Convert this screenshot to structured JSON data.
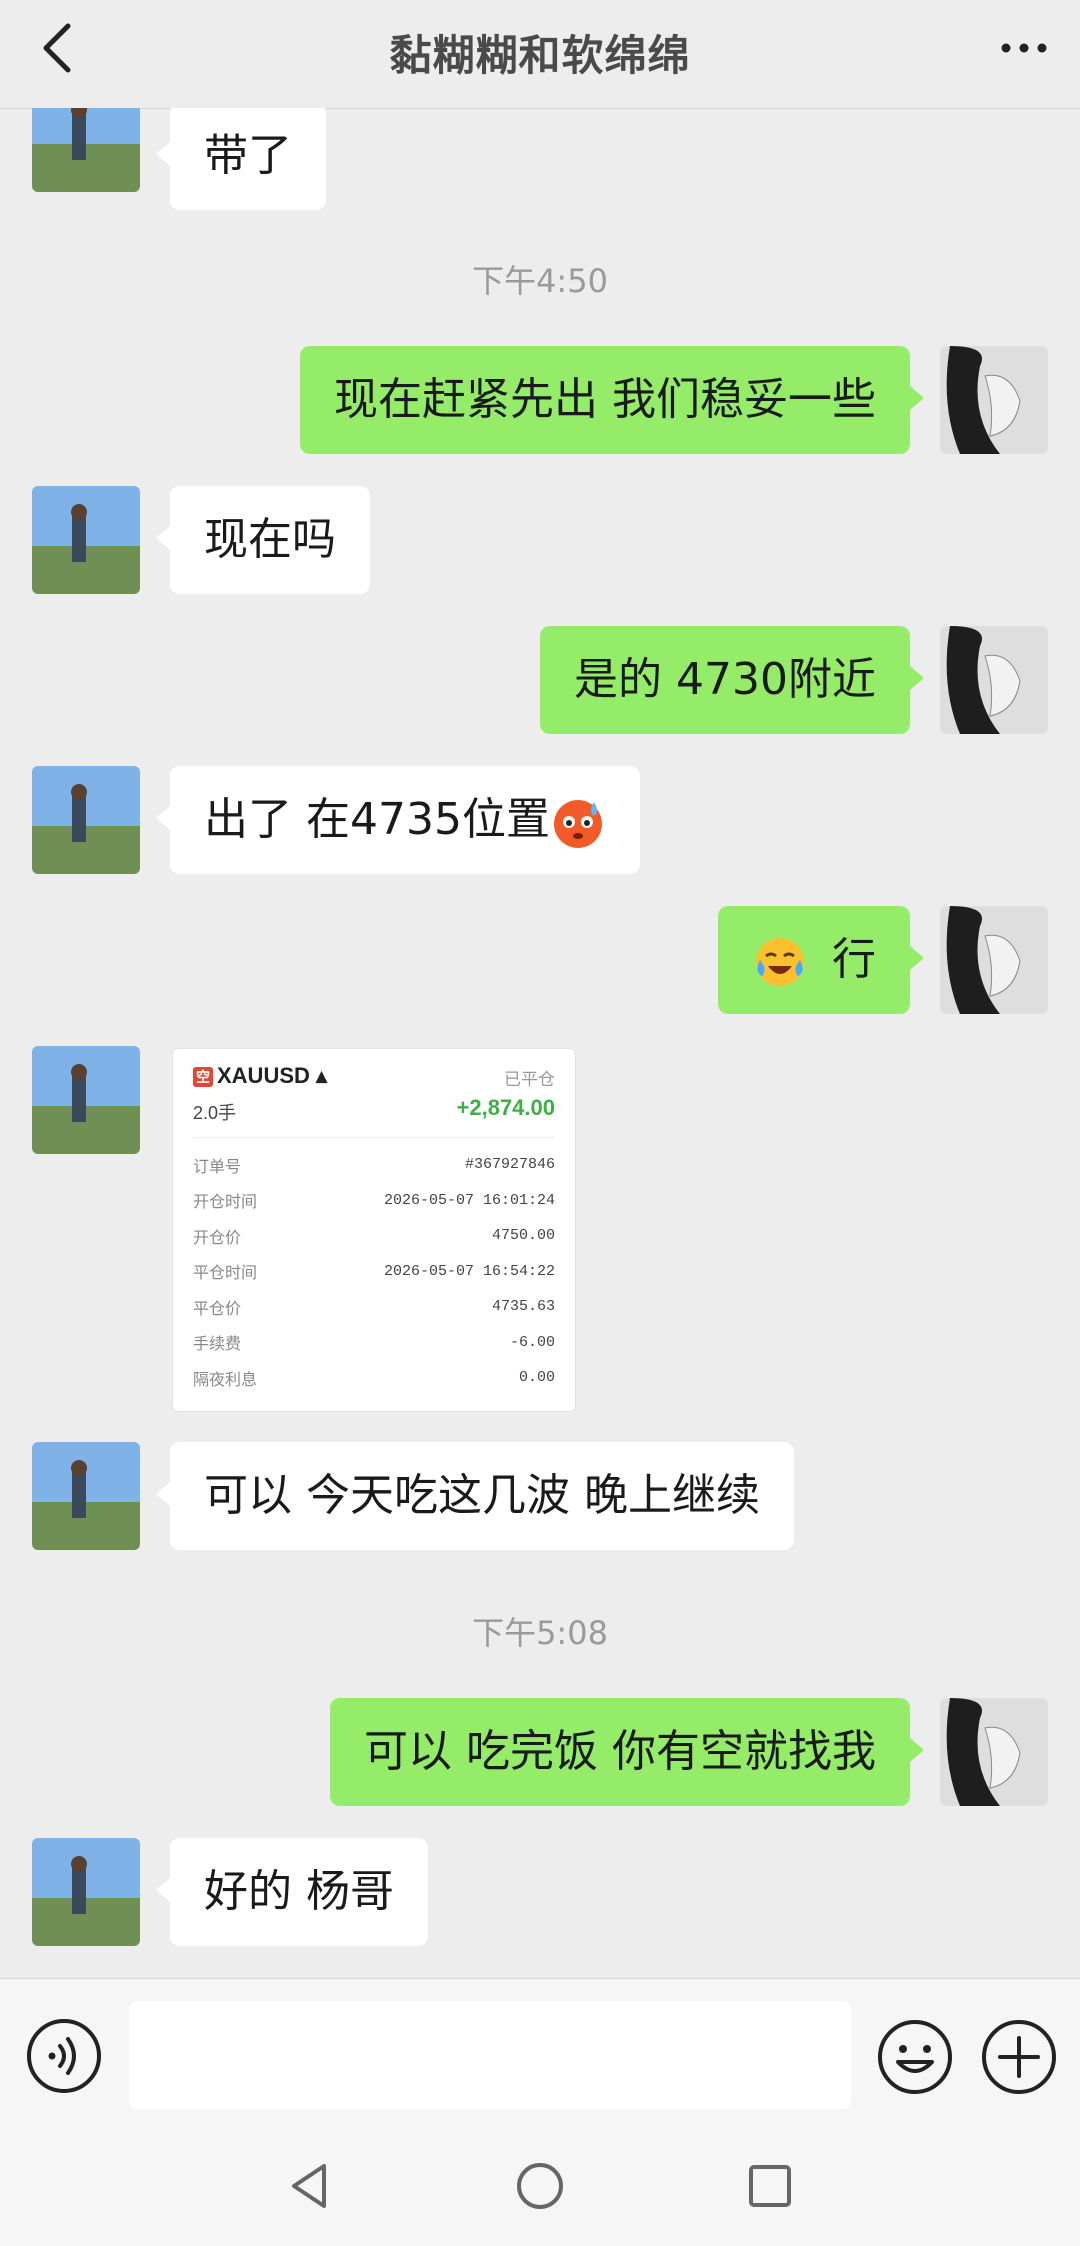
{
  "header": {
    "title": "黏糊糊和软绵绵"
  },
  "messages": [
    {
      "side": "in",
      "text": "带了"
    },
    {
      "time": "下午4:50"
    },
    {
      "side": "out",
      "text": "现在赶紧先出  我们稳妥一些"
    },
    {
      "side": "in",
      "text": "现在吗"
    },
    {
      "side": "out",
      "text": "是的  4730附近"
    },
    {
      "side": "in",
      "text": "出了  在4735位置",
      "emoji": "cold-sweat-face"
    },
    {
      "side": "out",
      "text": "行",
      "emoji": "crying-laughing-face"
    },
    {
      "side": "in",
      "type": "trade_card"
    },
    {
      "side": "in",
      "text": "可以  今天吃这几波  晚上继续"
    },
    {
      "time": "下午5:08"
    },
    {
      "side": "out",
      "text": "可以  吃完饭  你有空就找我"
    },
    {
      "side": "in",
      "text": "好的  杨哥"
    }
  ],
  "trade_card": {
    "logo_char": "空",
    "symbol": "XAUUSD",
    "status": "已平仓",
    "lots": "2.0手",
    "pnl": "+2,874.00",
    "rows": [
      {
        "label": "订单号",
        "value": "#367927846"
      },
      {
        "label": "开仓时间",
        "value": "2026-05-07 16:01:24"
      },
      {
        "label": "开仓价",
        "value": "4750.00"
      },
      {
        "label": "平仓时间",
        "value": "2026-05-07 16:54:22"
      },
      {
        "label": "平仓价",
        "value": "4735.63"
      },
      {
        "label": "手续费",
        "value": "-6.00"
      },
      {
        "label": "隔夜利息",
        "value": "0.00"
      }
    ]
  },
  "input": {
    "value": ""
  },
  "colors": {
    "out_bubble": "#95ec69",
    "in_bubble": "#ffffff",
    "background": "#ededed",
    "profit": "#3cb043"
  }
}
